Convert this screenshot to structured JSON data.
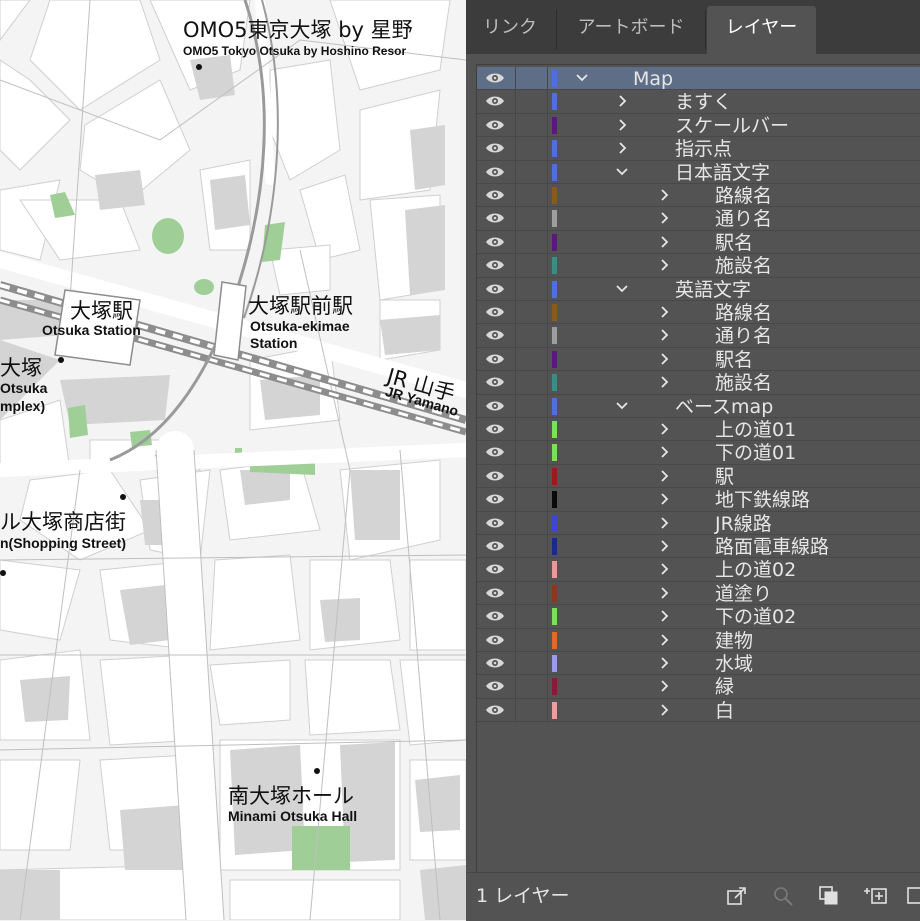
{
  "colors": {
    "panel_bg": "#535353",
    "tab_bar_bg": "#3c3c3c",
    "selection_bg": "#5e6e87",
    "map_bg": "#f4f4f4",
    "building": "#cfcfcf",
    "park": "#9fcf96",
    "rail": "#9a9a9a"
  },
  "map": {
    "labels": {
      "omo5_ja": "OMO5東京大塚 by 星野",
      "omo5_en": "OMO5 Tokyo Otsuka by Hoshino Resor",
      "otsuka_station_ja": "大塚駅",
      "otsuka_station_en": "Otsuka Station",
      "ekimae_ja": "大塚駅前駅",
      "ekimae_en1": "Otsuka-ekimae",
      "ekimae_en2": "Station",
      "left_otsuka_ja": "大塚",
      "left_otsuka_en1": "Otsuka",
      "left_otsuka_en2": "mplex)",
      "jr_ja": "JR 山手",
      "jr_en": "JR Yamano",
      "shopping_ja": "ル大塚商店街",
      "shopping_en": "n(Shopping Street)",
      "hall_ja": "南大塚ホール",
      "hall_en": "Minami Otsuka Hall"
    }
  },
  "panel": {
    "tabs": [
      "リンク",
      "アートボード",
      "レイヤー"
    ],
    "active_tab": 2,
    "layers": [
      {
        "name": "Map",
        "depth": 0,
        "expanded": true,
        "color": "#4f6fe0",
        "selected": true
      },
      {
        "name": "ますく",
        "depth": 1,
        "expanded": false,
        "color": "#4f6fe0"
      },
      {
        "name": "スケールバー",
        "depth": 1,
        "expanded": false,
        "color": "#5b1a7a"
      },
      {
        "name": "指示点",
        "depth": 1,
        "expanded": false,
        "color": "#4f6fe0"
      },
      {
        "name": "日本語文字",
        "depth": 1,
        "expanded": true,
        "color": "#4f6fe0"
      },
      {
        "name": "路線名",
        "depth": 2,
        "expanded": false,
        "color": "#8a5a1c"
      },
      {
        "name": "通り名",
        "depth": 2,
        "expanded": false,
        "color": "#9e9e9e"
      },
      {
        "name": "駅名",
        "depth": 2,
        "expanded": false,
        "color": "#5b1a7a"
      },
      {
        "name": "施設名",
        "depth": 2,
        "expanded": false,
        "color": "#3e8a84"
      },
      {
        "name": "英語文字",
        "depth": 1,
        "expanded": true,
        "color": "#4f6fe0"
      },
      {
        "name": "路線名",
        "depth": 2,
        "expanded": false,
        "color": "#8a5a1c"
      },
      {
        "name": "通り名",
        "depth": 2,
        "expanded": false,
        "color": "#9e9e9e"
      },
      {
        "name": "駅名",
        "depth": 2,
        "expanded": false,
        "color": "#5b1a7a"
      },
      {
        "name": "施設名",
        "depth": 2,
        "expanded": false,
        "color": "#3e8a84"
      },
      {
        "name": "ベースmap",
        "depth": 1,
        "expanded": true,
        "color": "#4f6fe0"
      },
      {
        "name": "上の道01",
        "depth": 2,
        "expanded": false,
        "color": "#7be05a"
      },
      {
        "name": "下の道01",
        "depth": 2,
        "expanded": false,
        "color": "#7be05a"
      },
      {
        "name": "駅",
        "depth": 2,
        "expanded": false,
        "color": "#9e1a1a"
      },
      {
        "name": "地下鉄線路",
        "depth": 2,
        "expanded": false,
        "color": "#0a0a0a"
      },
      {
        "name": "JR線路",
        "depth": 2,
        "expanded": false,
        "color": "#3f46d6"
      },
      {
        "name": "路面電車線路",
        "depth": 2,
        "expanded": false,
        "color": "#1a2a8a"
      },
      {
        "name": "上の道02",
        "depth": 2,
        "expanded": false,
        "color": "#e89a9a"
      },
      {
        "name": "道塗り",
        "depth": 2,
        "expanded": false,
        "color": "#8a3a1c"
      },
      {
        "name": "下の道02",
        "depth": 2,
        "expanded": false,
        "color": "#7be05a"
      },
      {
        "name": "建物",
        "depth": 2,
        "expanded": false,
        "color": "#e06a2a"
      },
      {
        "name": "水域",
        "depth": 2,
        "expanded": false,
        "color": "#9a9ae6"
      },
      {
        "name": "緑",
        "depth": 2,
        "expanded": false,
        "color": "#8a1a3a"
      },
      {
        "name": "白",
        "depth": 2,
        "expanded": false,
        "color": "#e8a0a0"
      }
    ],
    "footer": {
      "count_label": "1 レイヤー",
      "icons": [
        "export-icon",
        "search-icon",
        "clipping-mask-icon",
        "new-sublayer-icon",
        "new-layer-icon"
      ]
    }
  }
}
